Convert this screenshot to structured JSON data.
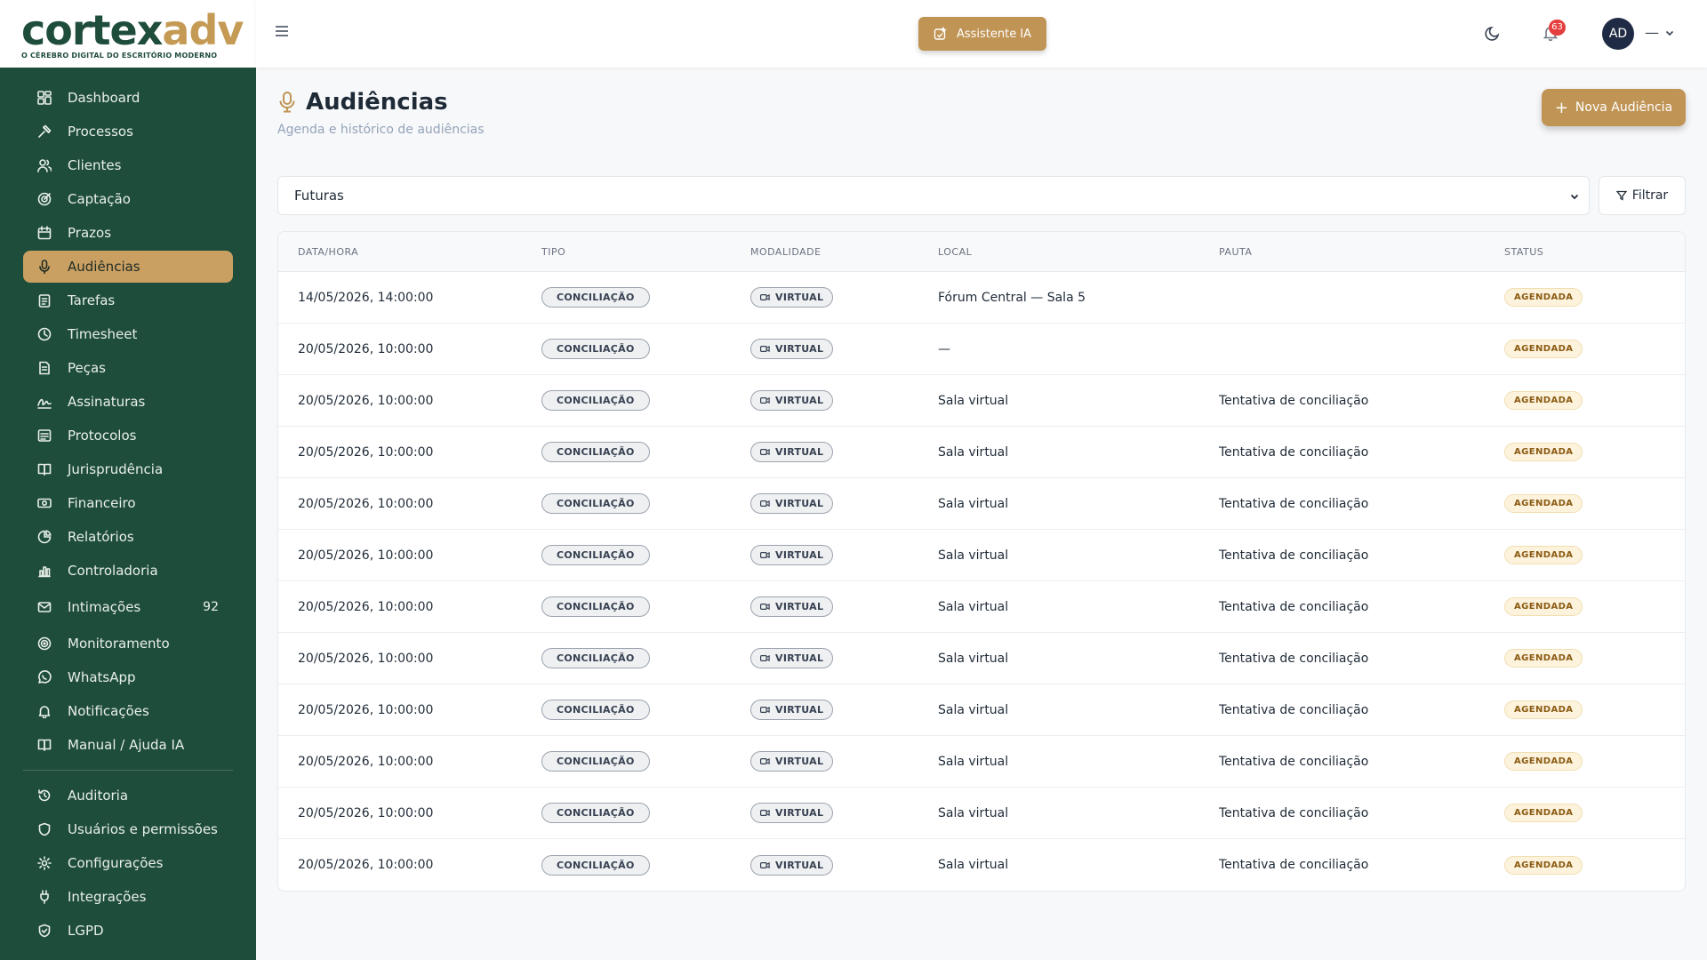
{
  "brand": {
    "name_part1": "cortex",
    "name_part2": "adv",
    "tagline": "O CÉREBRO DIGITAL DO ESCRITÓRIO MODERNO"
  },
  "sidebar": {
    "items": [
      {
        "label": "Dashboard",
        "icon": "dashboard-icon"
      },
      {
        "label": "Processos",
        "icon": "gavel-icon"
      },
      {
        "label": "Clientes",
        "icon": "users-icon"
      },
      {
        "label": "Captação",
        "icon": "target-icon"
      },
      {
        "label": "Prazos",
        "icon": "calendar-icon"
      },
      {
        "label": "Audiências",
        "icon": "mic-icon",
        "active": true
      },
      {
        "label": "Tarefas",
        "icon": "clipboard-icon"
      },
      {
        "label": "Timesheet",
        "icon": "clock-icon"
      },
      {
        "label": "Peças",
        "icon": "document-icon"
      },
      {
        "label": "Assinaturas",
        "icon": "signature-icon"
      },
      {
        "label": "Protocolos",
        "icon": "protocol-icon"
      },
      {
        "label": "Jurisprudência",
        "icon": "book-icon"
      },
      {
        "label": "Financeiro",
        "icon": "money-icon"
      },
      {
        "label": "Relatórios",
        "icon": "pie-chart-icon"
      },
      {
        "label": "Controladoria",
        "icon": "bar-chart-icon"
      },
      {
        "label": "Intimações",
        "icon": "mail-icon",
        "badge": "92"
      },
      {
        "label": "Monitoramento",
        "icon": "radar-icon"
      },
      {
        "label": "WhatsApp",
        "icon": "whatsapp-icon"
      },
      {
        "label": "Notificações",
        "icon": "bell-icon"
      },
      {
        "label": "Manual / Ajuda IA",
        "icon": "book-open-icon"
      }
    ],
    "admin_items": [
      {
        "label": "Auditoria",
        "icon": "history-icon"
      },
      {
        "label": "Usuários e permissões",
        "icon": "shield-icon"
      },
      {
        "label": "Configurações",
        "icon": "gear-icon"
      },
      {
        "label": "Integrações",
        "icon": "plug-icon"
      },
      {
        "label": "LGPD",
        "icon": "shield-check-icon"
      }
    ]
  },
  "topbar": {
    "assistant_label": "Assistente IA",
    "notification_count": "63",
    "avatar_initials": "AD",
    "user_name": "—"
  },
  "page": {
    "title": "Audiências",
    "subtitle": "Agenda e histórico de audiências",
    "new_button_label": "Nova Audiência",
    "filter_select_value": "Futuras",
    "filter_button_label": "Filtrar"
  },
  "table": {
    "headers": [
      "DATA/HORA",
      "TIPO",
      "MODALIDADE",
      "LOCAL",
      "PAUTA",
      "STATUS"
    ],
    "rows": [
      {
        "datetime": "14/05/2026, 14:00:00",
        "tipo": "CONCILIAÇÃO",
        "modalidade": "VIRTUAL",
        "local": "Fórum Central — Sala 5",
        "pauta": "",
        "status": "AGENDADA"
      },
      {
        "datetime": "20/05/2026, 10:00:00",
        "tipo": "CONCILIAÇÃO",
        "modalidade": "VIRTUAL",
        "local": "—",
        "pauta": "",
        "status": "AGENDADA"
      },
      {
        "datetime": "20/05/2026, 10:00:00",
        "tipo": "CONCILIAÇÃO",
        "modalidade": "VIRTUAL",
        "local": "Sala virtual",
        "pauta": "Tentativa de conciliação",
        "status": "AGENDADA"
      },
      {
        "datetime": "20/05/2026, 10:00:00",
        "tipo": "CONCILIAÇÃO",
        "modalidade": "VIRTUAL",
        "local": "Sala virtual",
        "pauta": "Tentativa de conciliação",
        "status": "AGENDADA"
      },
      {
        "datetime": "20/05/2026, 10:00:00",
        "tipo": "CONCILIAÇÃO",
        "modalidade": "VIRTUAL",
        "local": "Sala virtual",
        "pauta": "Tentativa de conciliação",
        "status": "AGENDADA"
      },
      {
        "datetime": "20/05/2026, 10:00:00",
        "tipo": "CONCILIAÇÃO",
        "modalidade": "VIRTUAL",
        "local": "Sala virtual",
        "pauta": "Tentativa de conciliação",
        "status": "AGENDADA"
      },
      {
        "datetime": "20/05/2026, 10:00:00",
        "tipo": "CONCILIAÇÃO",
        "modalidade": "VIRTUAL",
        "local": "Sala virtual",
        "pauta": "Tentativa de conciliação",
        "status": "AGENDADA"
      },
      {
        "datetime": "20/05/2026, 10:00:00",
        "tipo": "CONCILIAÇÃO",
        "modalidade": "VIRTUAL",
        "local": "Sala virtual",
        "pauta": "Tentativa de conciliação",
        "status": "AGENDADA"
      },
      {
        "datetime": "20/05/2026, 10:00:00",
        "tipo": "CONCILIAÇÃO",
        "modalidade": "VIRTUAL",
        "local": "Sala virtual",
        "pauta": "Tentativa de conciliação",
        "status": "AGENDADA"
      },
      {
        "datetime": "20/05/2026, 10:00:00",
        "tipo": "CONCILIAÇÃO",
        "modalidade": "VIRTUAL",
        "local": "Sala virtual",
        "pauta": "Tentativa de conciliação",
        "status": "AGENDADA"
      },
      {
        "datetime": "20/05/2026, 10:00:00",
        "tipo": "CONCILIAÇÃO",
        "modalidade": "VIRTUAL",
        "local": "Sala virtual",
        "pauta": "Tentativa de conciliação",
        "status": "AGENDADA"
      },
      {
        "datetime": "20/05/2026, 10:00:00",
        "tipo": "CONCILIAÇÃO",
        "modalidade": "VIRTUAL",
        "local": "Sala virtual",
        "pauta": "Tentativa de conciliação",
        "status": "AGENDADA"
      }
    ]
  },
  "colors": {
    "sidebar": "#1f4d3b",
    "accent_gold": "#c09455",
    "status_bg": "#fdf3dc"
  }
}
